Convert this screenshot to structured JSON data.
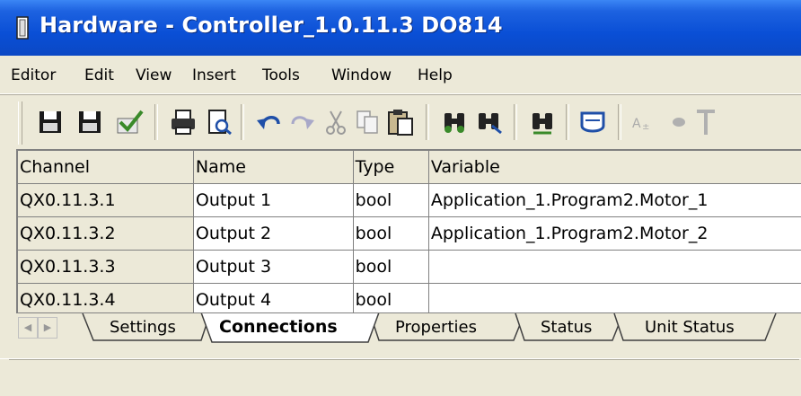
{
  "window": {
    "title": "Hardware - Controller_1.0.11.3  DO814"
  },
  "menu": [
    "Editor",
    "Edit",
    "View",
    "Insert",
    "Tools",
    "Window",
    "Help"
  ],
  "toolbar_icons": [
    "save-icon",
    "save-all-icon",
    "check-icon",
    "print-icon",
    "print-preview-icon",
    "undo-icon",
    "redo-icon",
    "cut-icon",
    "copy-icon",
    "paste-icon",
    "find-icon",
    "find-next-icon",
    "replace-icon",
    "monitor-icon",
    "font-icon",
    "bullet-icon",
    "more-icon"
  ],
  "grid": {
    "columns": [
      "Channel",
      "Name",
      "Type",
      "Variable"
    ],
    "rows": [
      [
        "QX0.11.3.1",
        "Output 1",
        "bool",
        "Application_1.Program2.Motor_1"
      ],
      [
        "QX0.11.3.2",
        "Output 2",
        "bool",
        "Application_1.Program2.Motor_2"
      ],
      [
        "QX0.11.3.3",
        "Output 3",
        "bool",
        ""
      ],
      [
        "QX0.11.3.4",
        "Output 4",
        "bool",
        ""
      ]
    ]
  },
  "tabs": [
    "Settings",
    "Connections",
    "Properties",
    "Status",
    "Unit Status"
  ],
  "active_tab": "Connections",
  "colors": {
    "title_bar": "#0a4fd6",
    "window_bg": "#ece9d8",
    "grid_lines": "#808080"
  }
}
